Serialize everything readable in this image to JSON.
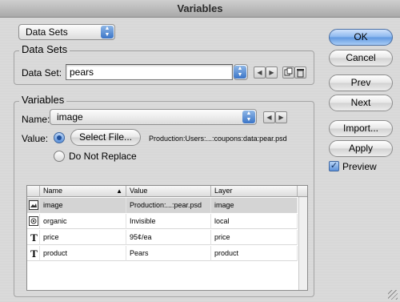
{
  "window": {
    "title": "Variables"
  },
  "top_select": {
    "value": "Data Sets"
  },
  "data_sets": {
    "group_label": "Data Sets",
    "field_label": "Data Set:",
    "value": "pears",
    "prev_icon": "triangle-left-icon",
    "next_icon": "triangle-right-icon"
  },
  "variables": {
    "group_label": "Variables",
    "name_label": "Name:",
    "name_value": "image",
    "value_label": "Value:",
    "select_file_label": "Select File...",
    "file_path": "Production:Users:...:coupons:data:pear.psd",
    "do_not_replace_label": "Do Not Replace"
  },
  "table": {
    "columns": [
      "Name",
      "Value",
      "Layer"
    ],
    "sort_indicator": "▲",
    "rows": [
      {
        "icon": "image-variable-icon",
        "name": "image",
        "value": "Production:...:pear.psd",
        "layer": "image",
        "selected": true
      },
      {
        "icon": "visibility-variable-icon",
        "name": "organic",
        "value": "Invisible",
        "layer": "local",
        "selected": false
      },
      {
        "icon": "text-variable-icon",
        "name": "price",
        "value": "95¢/ea",
        "layer": "price",
        "selected": false
      },
      {
        "icon": "text-variable-icon",
        "name": "product",
        "value": "Pears",
        "layer": "product",
        "selected": false
      }
    ]
  },
  "buttons": {
    "ok": "OK",
    "cancel": "Cancel",
    "prev": "Prev",
    "next": "Next",
    "import": "Import...",
    "apply": "Apply",
    "preview": "Preview"
  },
  "preview_checked": true,
  "colors": {
    "accent": "#5f97e0",
    "selection": "#d4d4d4"
  }
}
